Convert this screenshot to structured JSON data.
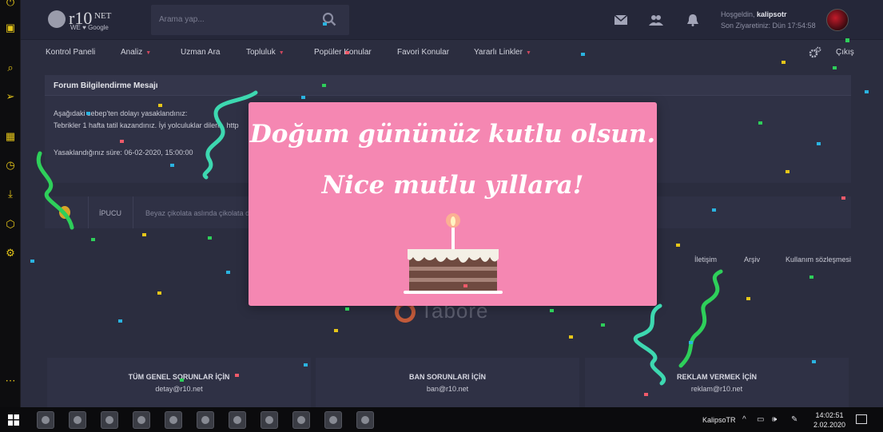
{
  "header": {
    "logo_text": "r10",
    "logo_net": "NET",
    "logo_sub": "WE ♥ Google",
    "search_placeholder": "Arama yap...",
    "greeting_prefix": "Hoşgeldin,",
    "username": "kalipsotr",
    "last_visit": "Son Ziyaretiniz: Dün 17:54:58"
  },
  "nav": {
    "items": [
      {
        "label": "Kontrol Paneli",
        "caret": false
      },
      {
        "label": "Analiz",
        "caret": true
      },
      {
        "label": "Uzman Ara",
        "caret": false
      },
      {
        "label": "Topluluk",
        "caret": true
      },
      {
        "label": "Popüler Konular",
        "caret": false
      },
      {
        "label": "Favori Konular",
        "caret": false
      },
      {
        "label": "Yararlı Linkler",
        "caret": true
      }
    ],
    "logout": "Çıkış"
  },
  "notice": {
    "title": "Forum Bilgilendirme Mesajı",
    "line1": "Aşağıdaki sebep'ten dolayı yasaklandınız:",
    "line2": "Tebrikler 1 hafta tatil kazandınız. İyi yolculuklar dileriz. http",
    "line3_prefix": "Yasaklandığınız süre: 06-02-2020,",
    "line3_time": "15:00:00"
  },
  "tip": {
    "label": "İPUCU",
    "text": "Beyaz çikolata aslında çikolata d"
  },
  "footer_links": [
    "İletişim",
    "Arşiv",
    "Kullanım sözleşmesi"
  ],
  "brand": "Tabore",
  "contacts": [
    {
      "title": "TÜM GENEL SORUNLAR İÇİN",
      "email": "detay@r10.net"
    },
    {
      "title": "BAN SORUNLARI İÇİN",
      "email": "ban@r10.net"
    },
    {
      "title": "REKLAM VERMEK İÇİN",
      "email": "reklam@r10.net"
    }
  ],
  "modal": {
    "line1": "Doğum gününüz kutlu olsun.",
    "line2": "Nice mutlu yıllara!"
  },
  "taskbar": {
    "user": "KalipsoTR",
    "time": "14:02:51",
    "date": "2.02.2020"
  },
  "colors": {
    "accent_yellow": "#e6c619",
    "modal_pink": "#f587b2",
    "caret_red": "#d0475e"
  }
}
